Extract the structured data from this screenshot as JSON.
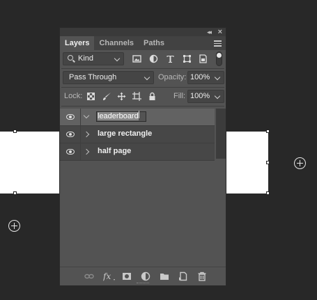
{
  "panel": {
    "tabs": [
      "Layers",
      "Channels",
      "Paths"
    ],
    "active_tab": "Layers"
  },
  "filter": {
    "kind_label": "Kind"
  },
  "blend": {
    "mode": "Pass Through",
    "opacity_label": "Opacity:",
    "opacity_value": "100%"
  },
  "lock": {
    "lock_label": "Lock:",
    "fill_label": "Fill:",
    "fill_value": "100%"
  },
  "layers": [
    {
      "name": "leaderboard",
      "type": "group",
      "expanded": false,
      "editing": true
    },
    {
      "name": "large rectangle",
      "type": "group",
      "expanded": false,
      "editing": false
    },
    {
      "name": "half page",
      "type": "group",
      "expanded": false,
      "editing": false
    }
  ],
  "colors": {
    "panel_bg": "#535353",
    "canvas_bg": "#282828",
    "selected_row": "#626262"
  }
}
